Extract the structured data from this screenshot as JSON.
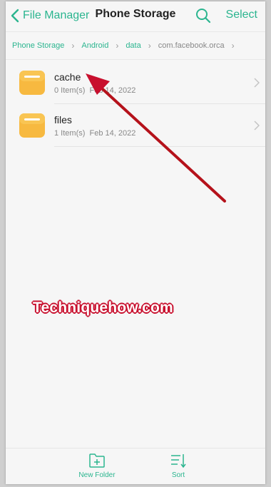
{
  "header": {
    "back_label": "File Manager",
    "title": "Phone Storage",
    "select_label": "Select",
    "icons": {
      "back": "chevron-left-icon",
      "search": "search-icon"
    }
  },
  "breadcrumb": [
    {
      "label": "Phone Storage"
    },
    {
      "label": "Android"
    },
    {
      "label": "data"
    },
    {
      "label": "com.facebook.orca"
    }
  ],
  "folders": [
    {
      "name": "cache",
      "items": "0 Item(s)",
      "date": "Feb 14, 2022"
    },
    {
      "name": "files",
      "items": "1 Item(s)",
      "date": "Feb 14, 2022"
    }
  ],
  "watermark": "Techniquehow.com",
  "bottom_bar": {
    "new_folder": "New Folder",
    "sort": "Sort",
    "icons": {
      "new_folder": "folder-plus-icon",
      "sort": "sort-icon"
    }
  },
  "colors": {
    "accent": "#2bb58f",
    "folder": "#f7b940",
    "annotation": "#c8102e"
  }
}
